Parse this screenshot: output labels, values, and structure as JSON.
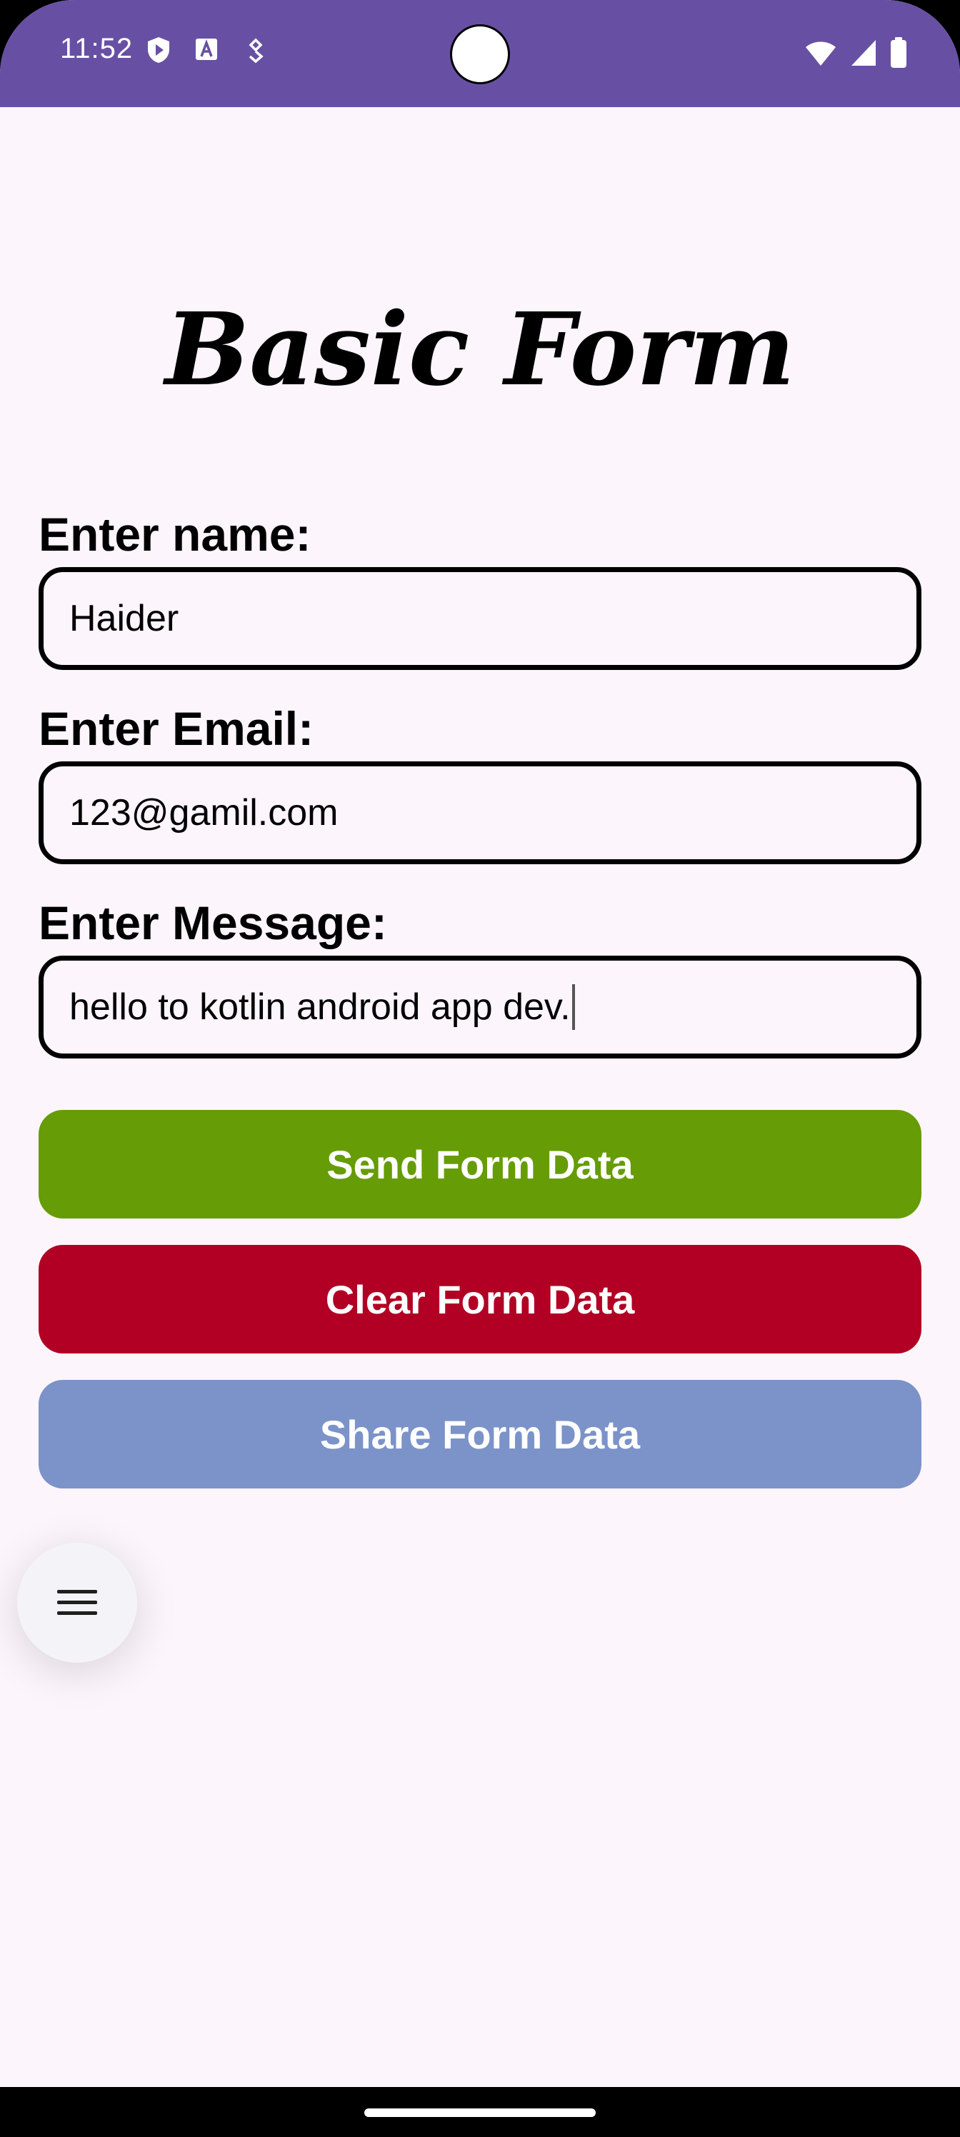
{
  "status_bar": {
    "time": "11:52",
    "left_icons": [
      "shield-play-icon",
      "font-a-icon",
      "location-tag-icon"
    ],
    "right_icons": [
      "wifi-icon",
      "cellular-signal-icon",
      "battery-icon"
    ],
    "color": "#6750A4"
  },
  "page": {
    "title": "Basic Form",
    "background": "#FCF5FB"
  },
  "form": {
    "name_label": "Enter name:",
    "name_value": "Haider",
    "email_label": "Enter Email:",
    "email_value": "123@gamil.com",
    "message_label": "Enter Message:",
    "message_value": "hello to kotlin android app dev."
  },
  "buttons": {
    "send": {
      "label": "Send Form Data",
      "color": "#669C05"
    },
    "clear": {
      "label": "Clear Form Data",
      "color": "#B10024"
    },
    "share": {
      "label": "Share Form Data",
      "color": "#7B93C9"
    }
  },
  "fab": {
    "icon": "menu-icon"
  }
}
